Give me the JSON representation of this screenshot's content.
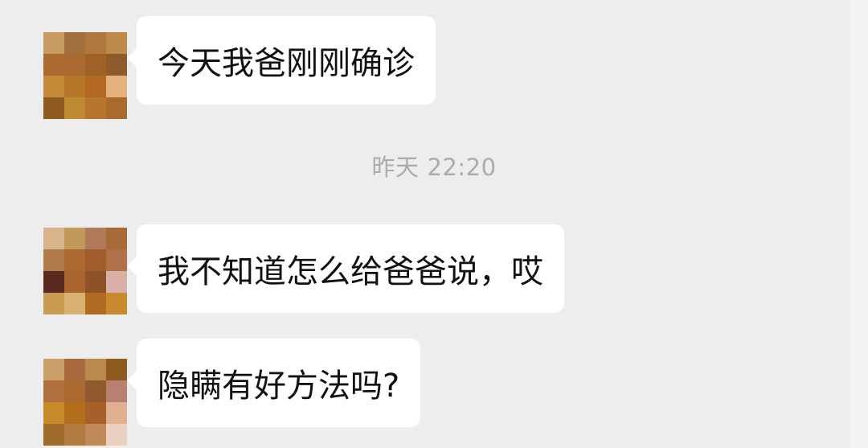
{
  "messages": [
    {
      "text": "今天我爸刚刚确诊"
    },
    {
      "text": "我不知道怎么给爸爸说，哎"
    },
    {
      "text": "隐瞒有好方法吗?"
    }
  ],
  "timestamp": {
    "day": "昨天",
    "time": "22:20"
  },
  "colors": {
    "background": "#ededed",
    "bubble": "#ffffff",
    "text": "#111111",
    "timestamp": "#ababab"
  },
  "avatars": [
    [
      "#c79a62",
      "#a3713e",
      "#b0783f",
      "#bd8a4a",
      "#a9692f",
      "#a9692f",
      "#9e6126",
      "#8f5a2c",
      "#c48a38",
      "#b7772a",
      "#b26a22",
      "#e3b07e",
      "#8f5a1f",
      "#c08a33",
      "#b6762d",
      "#a86a2d"
    ],
    [
      "#d8b48a",
      "#c19a5a",
      "#b07a5a",
      "#a86a38",
      "#b07a4a",
      "#a9692f",
      "#9e5d2a",
      "#b07048",
      "#5a2a20",
      "#a96430",
      "#8e5228",
      "#d9b0a8",
      "#c99a52",
      "#d8b070",
      "#b06a22",
      "#c9892e"
    ],
    [
      "#caa06a",
      "#a86a3e",
      "#b88a50",
      "#8f5a20",
      "#b07040",
      "#a9692f",
      "#8e5a2e",
      "#b88070",
      "#c88a28",
      "#b56e1c",
      "#a8602a",
      "#e0b090",
      "#a06a2a",
      "#b07a40",
      "#c08a5a",
      "#ead0c0"
    ]
  ]
}
